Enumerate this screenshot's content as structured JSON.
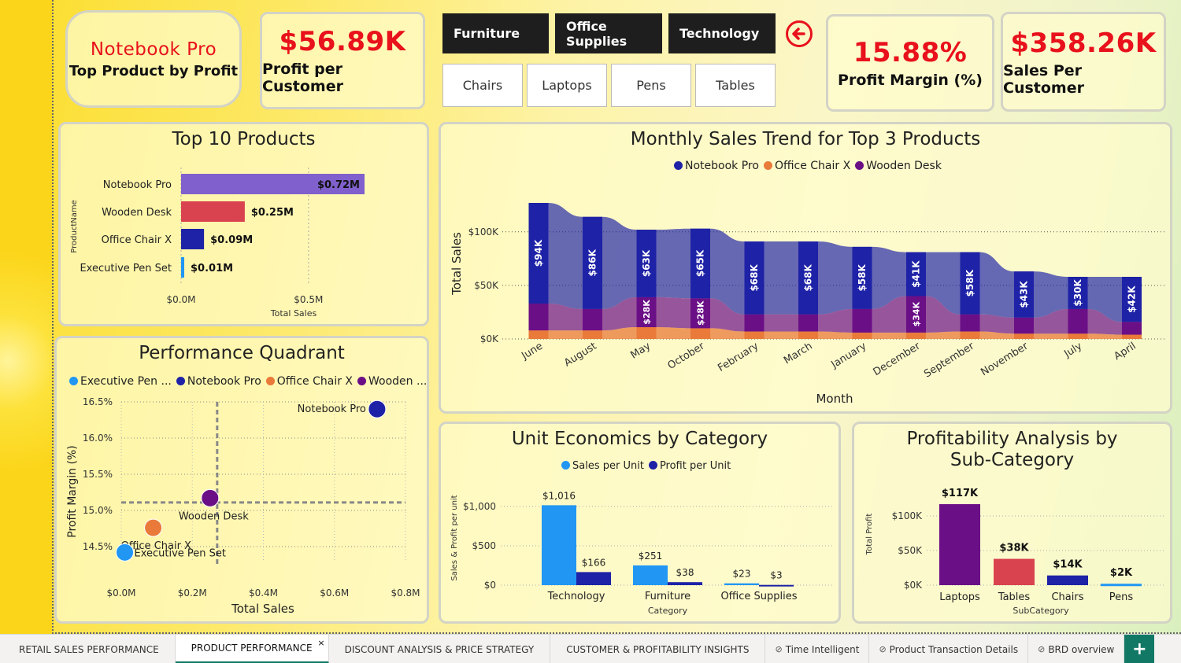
{
  "kpis": {
    "top_product": {
      "value": "Notebook Pro",
      "label": "Top Product by Profit"
    },
    "profit_per_customer": {
      "value": "$56.89K",
      "label": "Profit per Customer"
    },
    "profit_margin": {
      "value": "15.88%",
      "label": "Profit Margin (%)"
    },
    "sales_per_customer": {
      "value": "$358.26K",
      "label": "Sales Per Customer"
    }
  },
  "category_slicer": [
    "Furniture",
    "Office Supplies",
    "Technology"
  ],
  "subcategory_slicer": [
    "Chairs",
    "Laptops",
    "Pens",
    "Tables"
  ],
  "back_icon": "left-arrow-circle-icon",
  "colors": {
    "kpi_red": "#e8111c",
    "notebook": "#1e22a6",
    "chair": "#e97a3a",
    "desk": "#6b0f87",
    "pen": "#2196f3",
    "purple_bar": "#8060cc",
    "red_bar": "#d9434f",
    "tab_green": "#117865"
  },
  "top10": {
    "title": "Top 10 Products",
    "ylabel": "ProductName",
    "xlabel": "Total Sales",
    "ticks": [
      "$0.0M",
      "$0.5M"
    ]
  },
  "monthly": {
    "title": "Monthly Sales Trend for Top 3 Products",
    "legend": [
      "Notebook Pro",
      "Office Chair X",
      "Wooden Desk"
    ],
    "ylabel": "Total Sales",
    "xlabel": "Month",
    "yticks": [
      "$100K",
      "$50K",
      "$0K"
    ]
  },
  "quadrant": {
    "title": "Performance Quadrant",
    "legend": [
      "Executive Pen ...",
      "Notebook Pro",
      "Office Chair X",
      "Wooden ..."
    ],
    "ylabel": "Profit Margin (%)",
    "xlabel": "Total Sales",
    "yticks": [
      "16.5%",
      "16.0%",
      "15.5%",
      "15.0%",
      "14.5%"
    ],
    "xticks": [
      "$0.0M",
      "$0.2M",
      "$0.4M",
      "$0.6M",
      "$0.8M"
    ]
  },
  "unit": {
    "title": "Unit Economics by Category",
    "legend": [
      "Sales per Unit",
      "Profit per Unit"
    ],
    "ylabel": "Sales & Profit per unit",
    "xlabel": "Category",
    "yticks": [
      "$1,000",
      "$500",
      "$0"
    ]
  },
  "profitability": {
    "title_line1": "Profitability Analysis by",
    "title_line2": "Sub-Category",
    "ylabel": "Total Profit",
    "xlabel": "SubCategory",
    "yticks": [
      "$100K",
      "$50K",
      "$0K"
    ]
  },
  "chart_data": [
    {
      "type": "bar",
      "name": "Top 10 Products",
      "categories": [
        "Notebook Pro",
        "Wooden Desk",
        "Office Chair X",
        "Executive Pen Set"
      ],
      "values": [
        0.72,
        0.25,
        0.09,
        0.01
      ],
      "labels": [
        "$0.72M",
        "$0.25M",
        "$0.09M",
        "$0.01M"
      ],
      "xlabel": "Total Sales",
      "ylabel": "ProductName",
      "xlim": [
        0,
        0.72
      ],
      "grid": true
    },
    {
      "type": "area",
      "name": "Monthly Sales Trend for Top 3 Products",
      "categories": [
        "June",
        "August",
        "May",
        "October",
        "February",
        "March",
        "January",
        "December",
        "September",
        "November",
        "July",
        "April"
      ],
      "series": [
        {
          "name": "Office Chair X",
          "values": [
            8,
            8,
            11,
            10,
            7,
            7,
            6,
            6,
            7,
            5,
            5,
            4
          ]
        },
        {
          "name": "Wooden Desk",
          "values": [
            25,
            20,
            28,
            28,
            16,
            16,
            22,
            34,
            16,
            15,
            23,
            12
          ]
        },
        {
          "name": "Notebook Pro",
          "values": [
            94,
            86,
            63,
            65,
            68,
            68,
            58,
            41,
            58,
            43,
            30,
            42
          ]
        }
      ],
      "totals": [
        127,
        114,
        102,
        103,
        91,
        91,
        86,
        81,
        81,
        63,
        58,
        58
      ],
      "notebook_labels": [
        "$94K",
        "$86K",
        "$63K",
        "$65K",
        "$68K",
        "$68K",
        "$58K",
        "$41K",
        "$58K",
        "$43K",
        "$30K",
        "$42K"
      ],
      "desk_labels": [
        "",
        "",
        "$28K",
        "$28K",
        "",
        "",
        "",
        "$34K",
        "",
        "",
        "",
        ""
      ],
      "ylim": [
        0,
        140
      ],
      "yunits": "K",
      "xlabel": "Month",
      "ylabel": "Total Sales",
      "legend": "top"
    },
    {
      "type": "scatter",
      "name": "Performance Quadrant",
      "points": [
        {
          "name": "Notebook Pro",
          "label": "Notebook Pro",
          "x": 0.72,
          "y": 16.4
        },
        {
          "name": "Wooden Desk",
          "label": "Wooden Desk",
          "x": 0.25,
          "y": 15.17
        },
        {
          "name": "Office Chair X",
          "label": "Office Chair X",
          "x": 0.09,
          "y": 14.76
        },
        {
          "name": "Executive Pen Set",
          "label": "Executive Pen Set",
          "x": 0.01,
          "y": 14.42
        }
      ],
      "xlim": [
        0,
        0.8
      ],
      "ylim": [
        14.3,
        16.5
      ],
      "ref_x": 0.27,
      "ref_y": 15.11,
      "xlabel": "Total Sales",
      "ylabel": "Profit Margin (%)"
    },
    {
      "type": "bar",
      "name": "Unit Economics by Category",
      "categories": [
        "Technology",
        "Furniture",
        "Office Supplies"
      ],
      "series": [
        {
          "name": "Sales per Unit",
          "values": [
            1016,
            251,
            23
          ],
          "labels": [
            "$1,016",
            "$251",
            "$23"
          ]
        },
        {
          "name": "Profit per Unit",
          "values": [
            166,
            38,
            3
          ],
          "labels": [
            "$166",
            "$38",
            "$3"
          ]
        }
      ],
      "ylim": [
        0,
        1100
      ],
      "xlabel": "Category",
      "ylabel": "Sales & Profit per unit"
    },
    {
      "type": "bar",
      "name": "Profitability Analysis by Sub-Category",
      "categories": [
        "Laptops",
        "Tables",
        "Chairs",
        "Pens"
      ],
      "values": [
        117,
        38,
        14,
        2
      ],
      "labels": [
        "$117K",
        "$38K",
        "$14K",
        "$2K"
      ],
      "ylim": [
        0,
        117
      ],
      "xlabel": "SubCategory",
      "ylabel": "Total Profit"
    }
  ],
  "tabs": [
    {
      "label": "RETAIL SALES PERFORMANCE",
      "active": false
    },
    {
      "label": "PRODUCT PERFORMANCE",
      "active": true
    },
    {
      "label": "DISCOUNT ANALYSIS & PRICE STRATEGY",
      "active": false
    },
    {
      "label": "CUSTOMER & PROFITABILITY INSIGHTS",
      "active": false
    },
    {
      "label": "Time Intelligent",
      "active": false,
      "icon": "hidden-page-icon"
    },
    {
      "label": "Product Transaction Details",
      "active": false,
      "icon": "hidden-page-icon"
    },
    {
      "label": "BRD overview",
      "active": false,
      "icon": "hidden-page-icon"
    }
  ],
  "tab_close": "×",
  "add_page": "+"
}
